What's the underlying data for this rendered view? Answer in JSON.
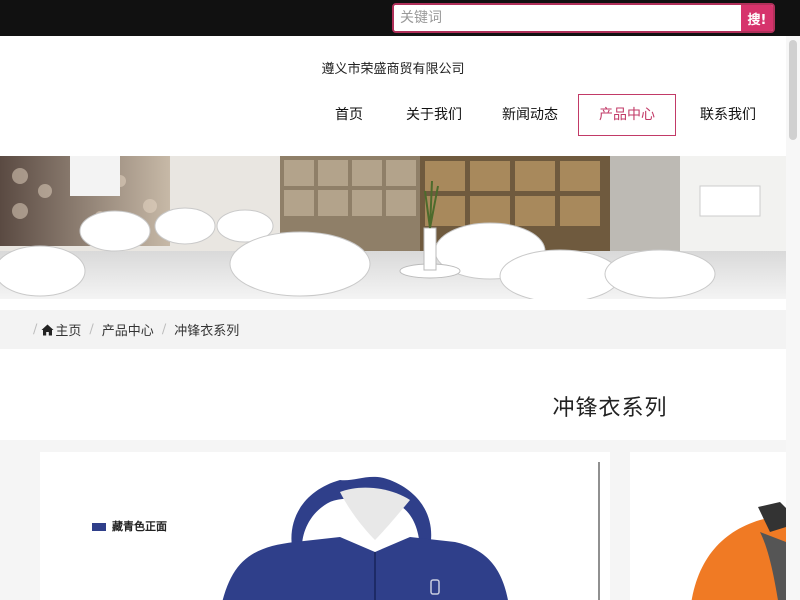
{
  "search": {
    "placeholder": "关键词",
    "button_label": "搜!"
  },
  "header": {
    "company_name": "遵义市荣盛商贸有限公司"
  },
  "nav": {
    "items": [
      {
        "label": "首页"
      },
      {
        "label": "关于我们"
      },
      {
        "label": "新闻动态"
      },
      {
        "label": "产品中心",
        "active": true
      },
      {
        "label": "联系我们"
      }
    ]
  },
  "breadcrumb": {
    "items": [
      "主页",
      "产品中心",
      "冲锋衣系列"
    ]
  },
  "section": {
    "title": "冲锋衣系列"
  },
  "products": [
    {
      "caption": "藏青色正面",
      "color": "#2f3f8a"
    },
    {
      "caption": "",
      "color": "#f07a24"
    }
  ],
  "colors": {
    "accent": "#d6336c",
    "topbar": "#111111",
    "active_nav": "#c23a67"
  },
  "icons": {
    "home": "home-icon"
  }
}
